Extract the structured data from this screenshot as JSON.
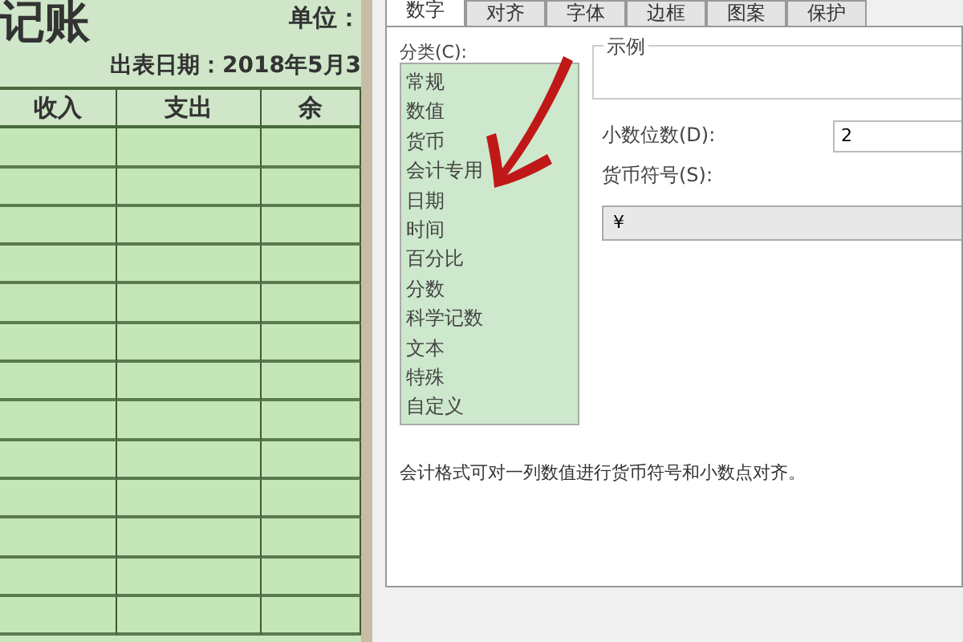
{
  "sheet": {
    "title": "记账",
    "unit_label": "单位：",
    "date_line": "出表日期：2018年5月3",
    "columns": [
      "收入",
      "支出",
      "余"
    ]
  },
  "dialog": {
    "tabs": [
      {
        "label": "数字",
        "selected": true
      },
      {
        "label": "对齐",
        "selected": false
      },
      {
        "label": "字体",
        "selected": false
      },
      {
        "label": "边框",
        "selected": false
      },
      {
        "label": "图案",
        "selected": false
      },
      {
        "label": "保护",
        "selected": false
      }
    ],
    "category_label": "分类(C):",
    "categories": [
      "常规",
      "数值",
      "货币",
      "会计专用",
      "日期",
      "时间",
      "百分比",
      "分数",
      "科学记数",
      "文本",
      "特殊",
      "自定义"
    ],
    "sample_label": "示例",
    "decimal_label": "小数位数(D):",
    "decimal_value": "2",
    "currency_label": "货币符号(S):",
    "currency_value": "¥",
    "description": "会计格式可对一列数值进行货币符号和小数点对齐。"
  }
}
